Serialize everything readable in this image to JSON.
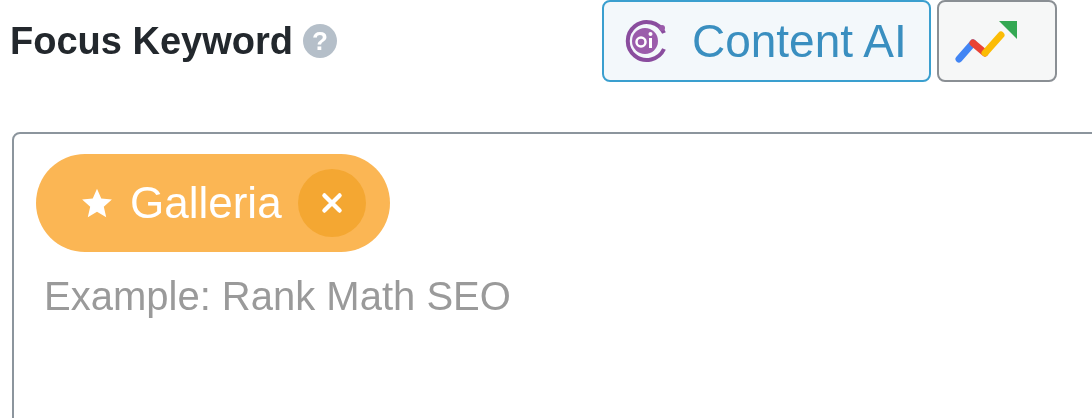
{
  "heading": {
    "title": "Focus Keyword",
    "help": "?"
  },
  "buttons": [
    {
      "kind": "content-ai",
      "label": "Content AI"
    },
    {
      "kind": "trends"
    }
  ],
  "keyword_field": {
    "keywords": [
      {
        "label": "Galleria",
        "primary": true
      }
    ],
    "placeholder": "Example: Rank Math SEO"
  }
}
